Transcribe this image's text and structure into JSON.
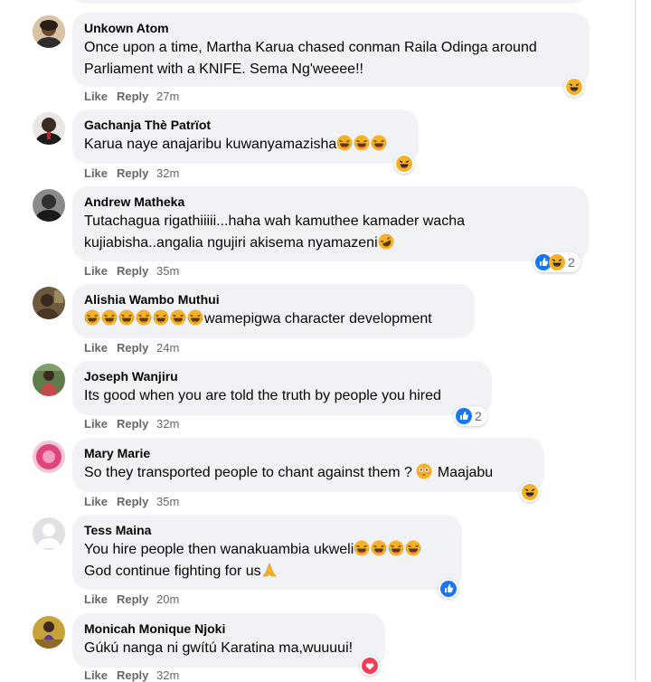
{
  "comments": [
    {
      "author": "Unkown Atom",
      "text": "Once upon a time, Martha Karua chased conman Raila Odinga around Parliament with a KNIFE. Sema Ng'weeee!!",
      "like": "Like",
      "reply": "Reply",
      "time": "27m",
      "reactions": [
        "haha"
      ],
      "reaction_count": ""
    },
    {
      "author": "Gachanja Thè Patrïot",
      "text": "Karua naye anajaribu kuwanyamazisha",
      "emoji_count": 3,
      "like": "Like",
      "reply": "Reply",
      "time": "32m",
      "reactions": [
        "haha"
      ],
      "reaction_count": ""
    },
    {
      "author": "Andrew Matheka",
      "text": "Tutachagua rigathiiiii...haha wah kamuthee kamader wacha kujiabisha..angalia ngujiri akisema nyamazeni",
      "emoji_trail": "rofl",
      "like": "Like",
      "reply": "Reply",
      "time": "35m",
      "reactions": [
        "like",
        "haha"
      ],
      "reaction_count": "2"
    },
    {
      "author": "Alishia Wambo Muthui",
      "text": "wamepigwa character development",
      "emoji_lead_count": 7,
      "like": "Like",
      "reply": "Reply",
      "time": "24m",
      "reactions": [],
      "reaction_count": ""
    },
    {
      "author": "Joseph Wanjiru",
      "text": "Its good when you are told the truth by people you hired",
      "like": "Like",
      "reply": "Reply",
      "time": "32m",
      "reactions": [
        "like"
      ],
      "reaction_count": "2"
    },
    {
      "author": "Mary Marie",
      "text": "So they transported people to chant against them ?",
      "text_after": "Maajabu",
      "like": "Like",
      "reply": "Reply",
      "time": "35m",
      "reactions": [
        "haha"
      ],
      "reaction_count": ""
    },
    {
      "author": "Tess Maina",
      "text": "You hire people then wanakuambia ukweli",
      "emoji_count": 4,
      "text2": "God continue fighting for us",
      "like": "Like",
      "reply": "Reply",
      "time": "20m",
      "reactions": [
        "like"
      ],
      "reaction_count": ""
    },
    {
      "author": "Monicah Monique Njoki",
      "text": "Gúkú nanga ni gwítú Karatina ma,wuuuui!",
      "like": "Like",
      "reply": "Reply",
      "time": "32m",
      "reactions": [
        "love"
      ],
      "reaction_count": ""
    }
  ],
  "colors": {
    "like_blue": "#1877f2",
    "haha_yellow": "#f7b125",
    "love_red": "#f33e58",
    "bubble": "#f0f2f5",
    "meta": "#65676b"
  }
}
